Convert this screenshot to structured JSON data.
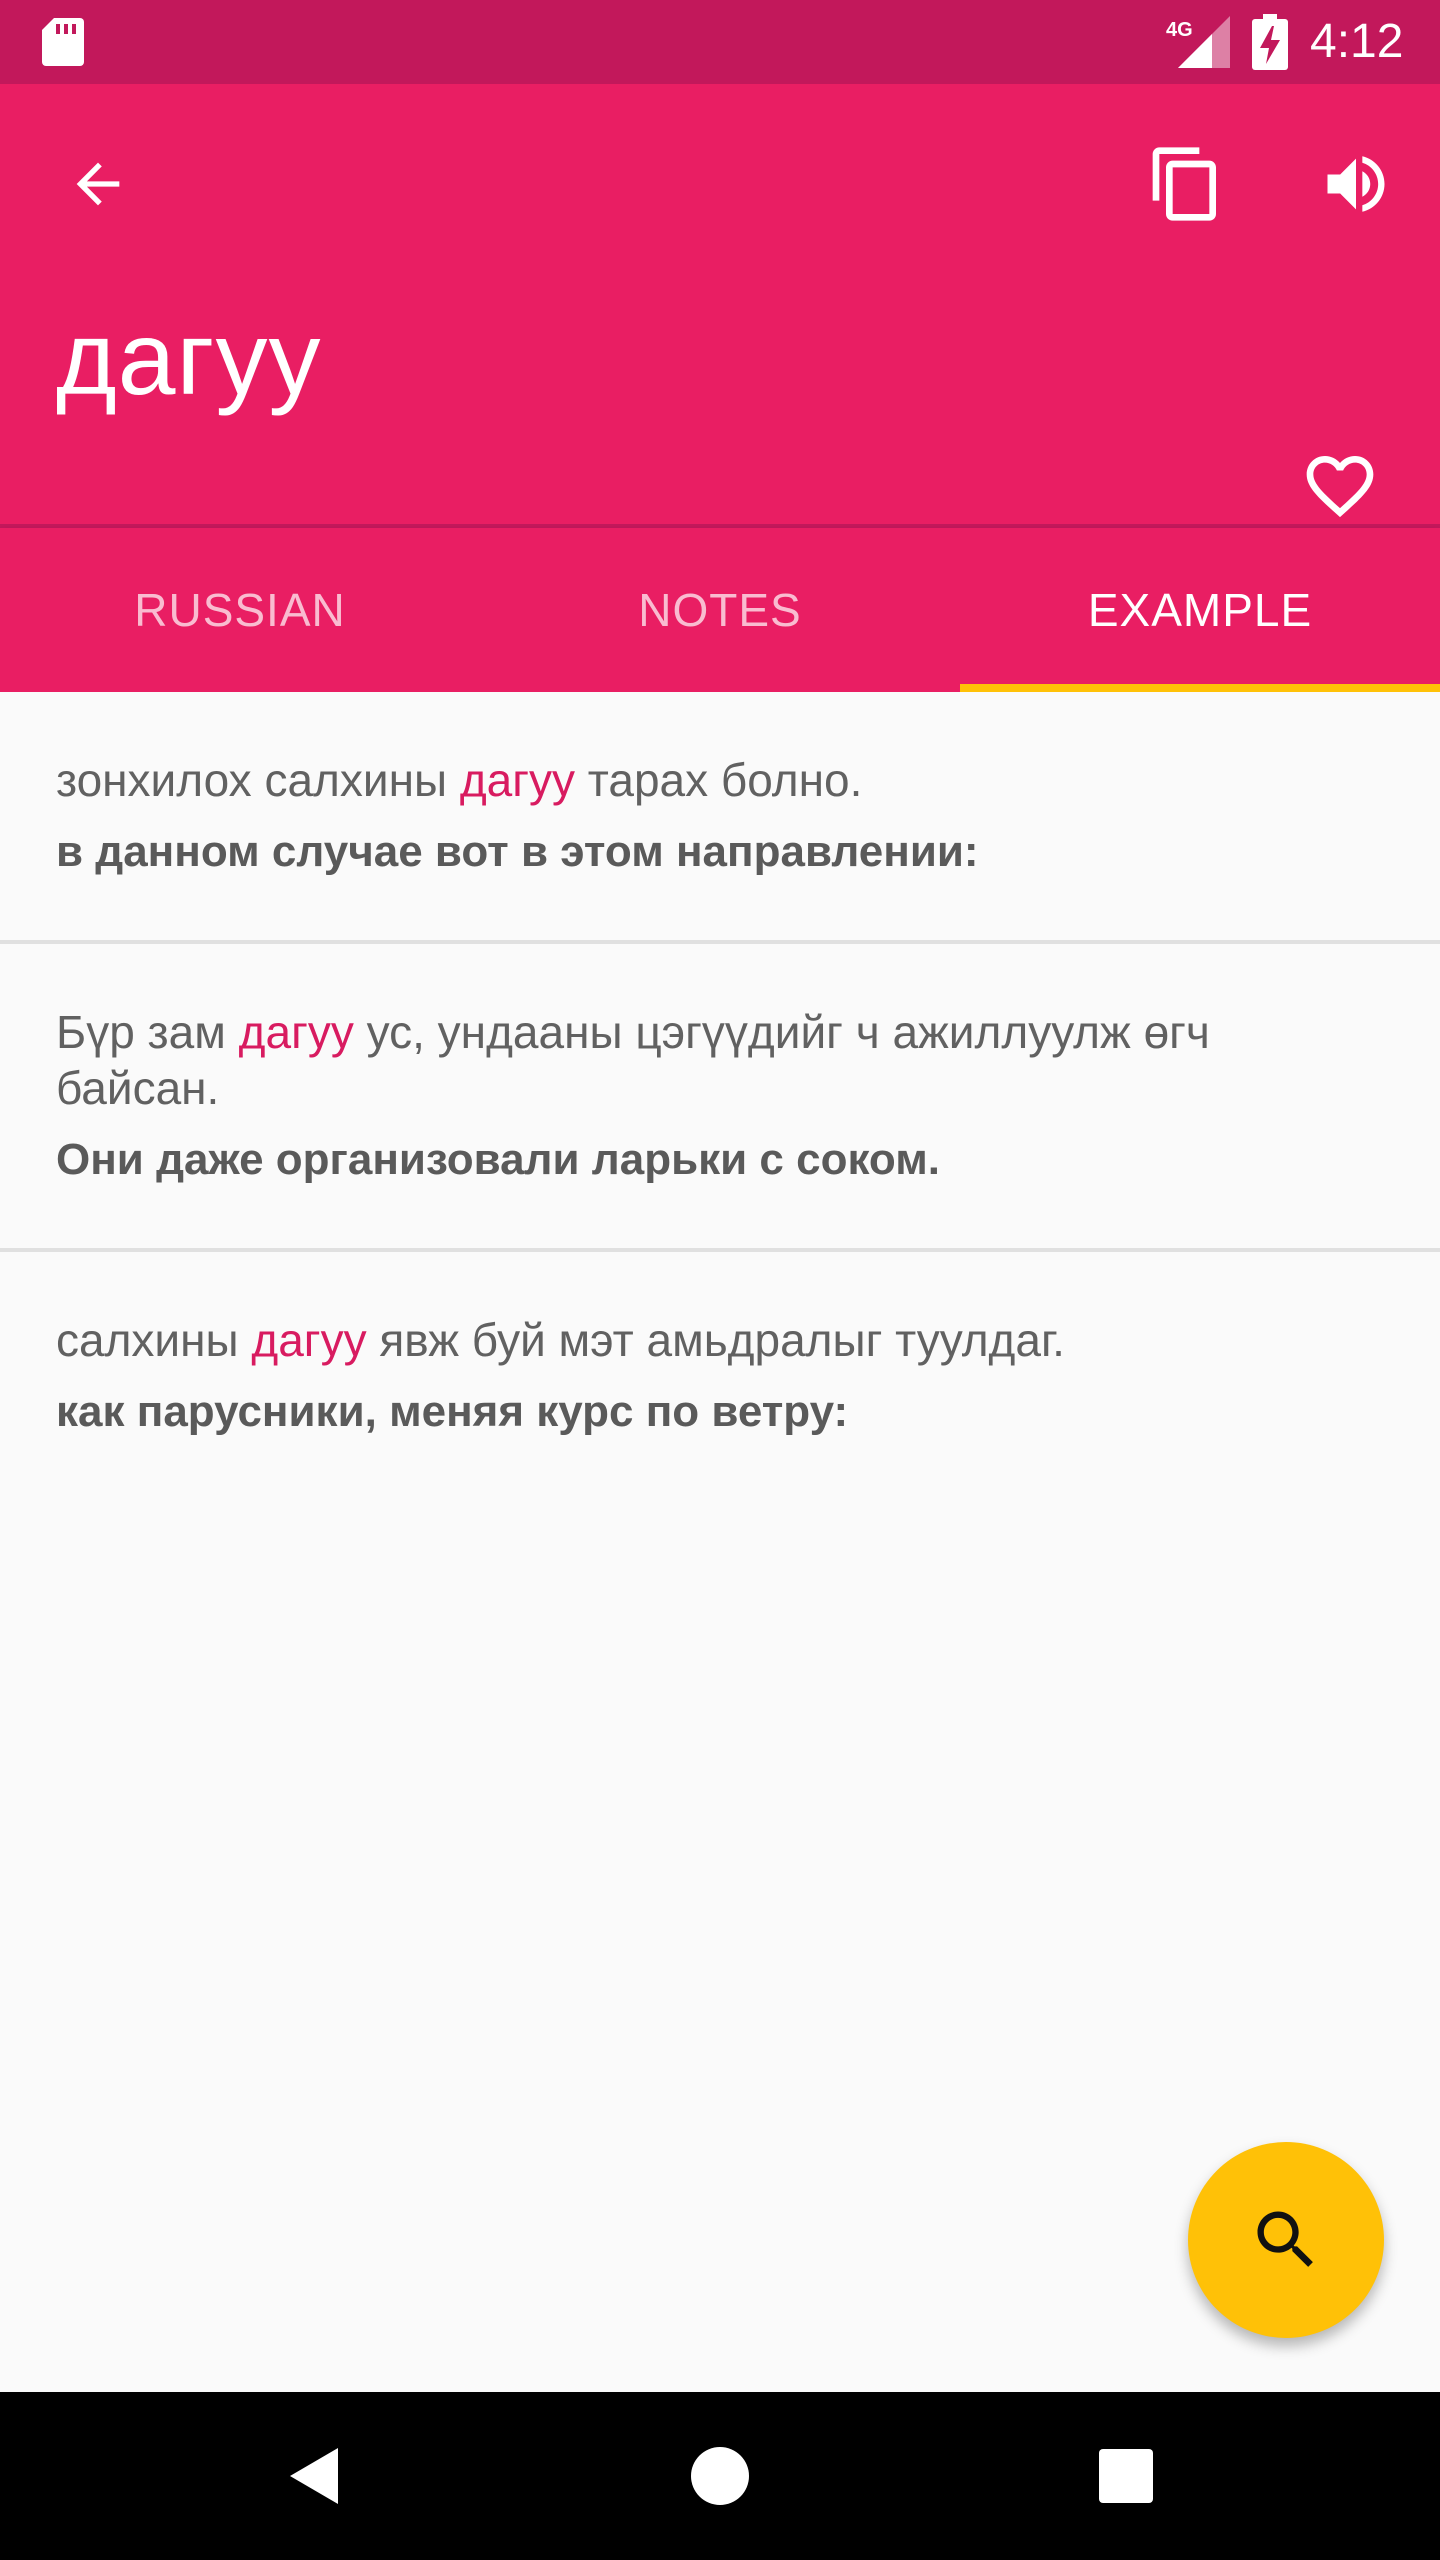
{
  "status_bar": {
    "time": "4:12",
    "network_label": "4G",
    "icons": [
      "sd-card-icon",
      "signal-icon",
      "battery-charging-icon"
    ]
  },
  "app_bar": {
    "word": "дагуу",
    "icons": [
      "arrow-back-icon",
      "copy-icon",
      "volume-up-icon",
      "heart-outline-icon"
    ]
  },
  "tabs": [
    {
      "label": "RUSSIAN",
      "active": false
    },
    {
      "label": "NOTES",
      "active": false
    },
    {
      "label": "EXAMPLE",
      "active": true
    }
  ],
  "examples": [
    {
      "source_before": "зонхилох салхины ",
      "source_highlight": "дагуу",
      "source_after": " тарах болно.",
      "translation": "в данном случае вот в этом направлении:"
    },
    {
      "source_before": "Бүр зам ",
      "source_highlight": "дагуу",
      "source_after": " ус, ундааны цэгүүдийг ч ажиллуулж өгч байсан.",
      "translation": "Они даже организовали ларьки с соком."
    },
    {
      "source_before": "салхины ",
      "source_highlight": "дагуу",
      "source_after": " явж буй мэт амьдралыг туулдаг.",
      "translation": "как парусники, меняя курс по ветру:"
    }
  ],
  "fab": {
    "icon": "search-icon"
  },
  "colors": {
    "primary": "#e91e63",
    "primary_dark": "#c2185b",
    "accent": "#ffc107",
    "highlight": "#d81b60"
  }
}
